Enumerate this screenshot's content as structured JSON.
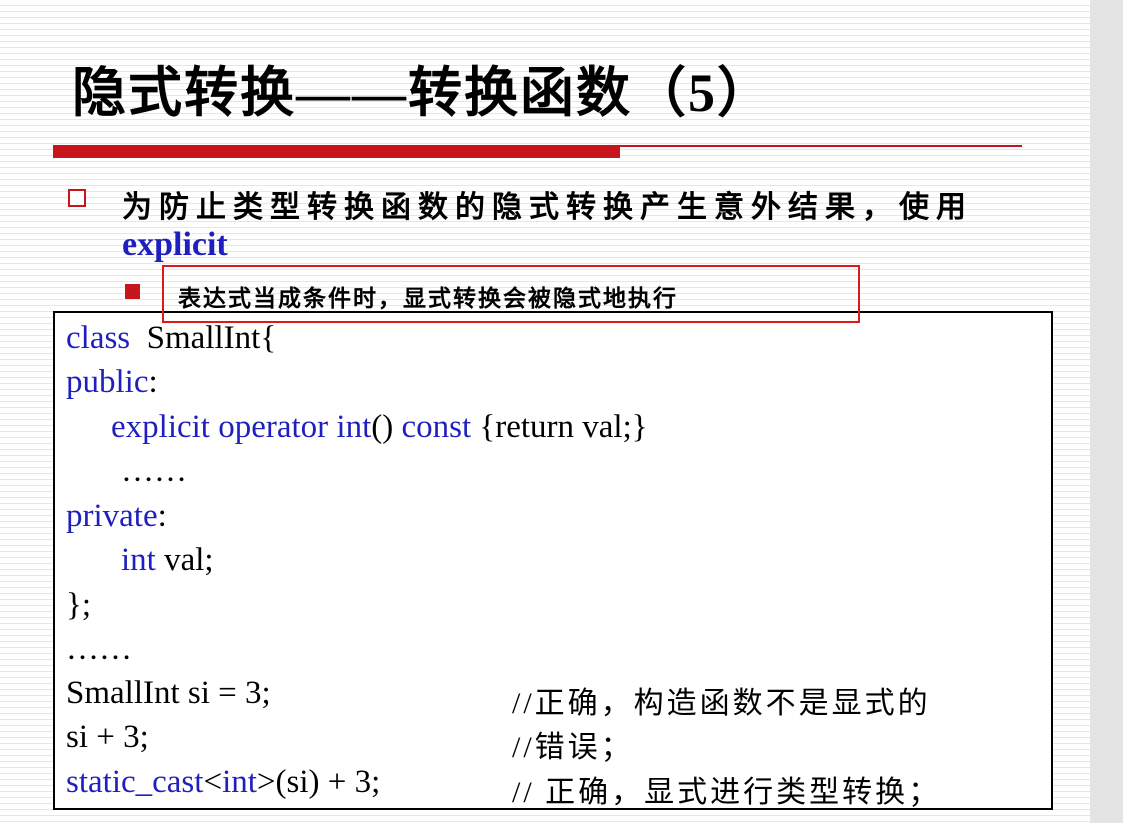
{
  "title": "隐式转换——转换函数（5）",
  "bullet1": {
    "text": "为防止类型转换函数的隐式转换产生意外结果，使用",
    "keyword": "explicit"
  },
  "bullet2": {
    "text": "表达式当成条件时，显式转换会被隐式地执行"
  },
  "code": {
    "l1_kw": "class",
    "l1_rest": "  SmallInt{",
    "l2_kw": "public",
    "l2_rest": ":",
    "l3_kw": "explicit operator int",
    "l3_mid": "() ",
    "l3_kw2": "const",
    "l3_rest": " {return val;}",
    "l4": "……",
    "l5_kw": "private",
    "l5_rest": ":",
    "l6_kw": "int",
    "l6_rest": " val;",
    "l7": "};",
    "l8": "……",
    "l9": "SmallInt si = 3;",
    "l9_comment": "//正确，构造函数不是显式的",
    "l10": "si + 3;",
    "l10_comment": "//错误；",
    "l11_kw": "static_cast",
    "l11_lt": "<",
    "l11_kw2": "int",
    "l11_rest": ">(si) + 3;",
    "l11_comment": "// 正确，显式进行类型转换；"
  },
  "colors": {
    "accent_red": "#c8141c",
    "highlight_red": "#e01818",
    "keyword_blue": "#1f1fbf"
  }
}
